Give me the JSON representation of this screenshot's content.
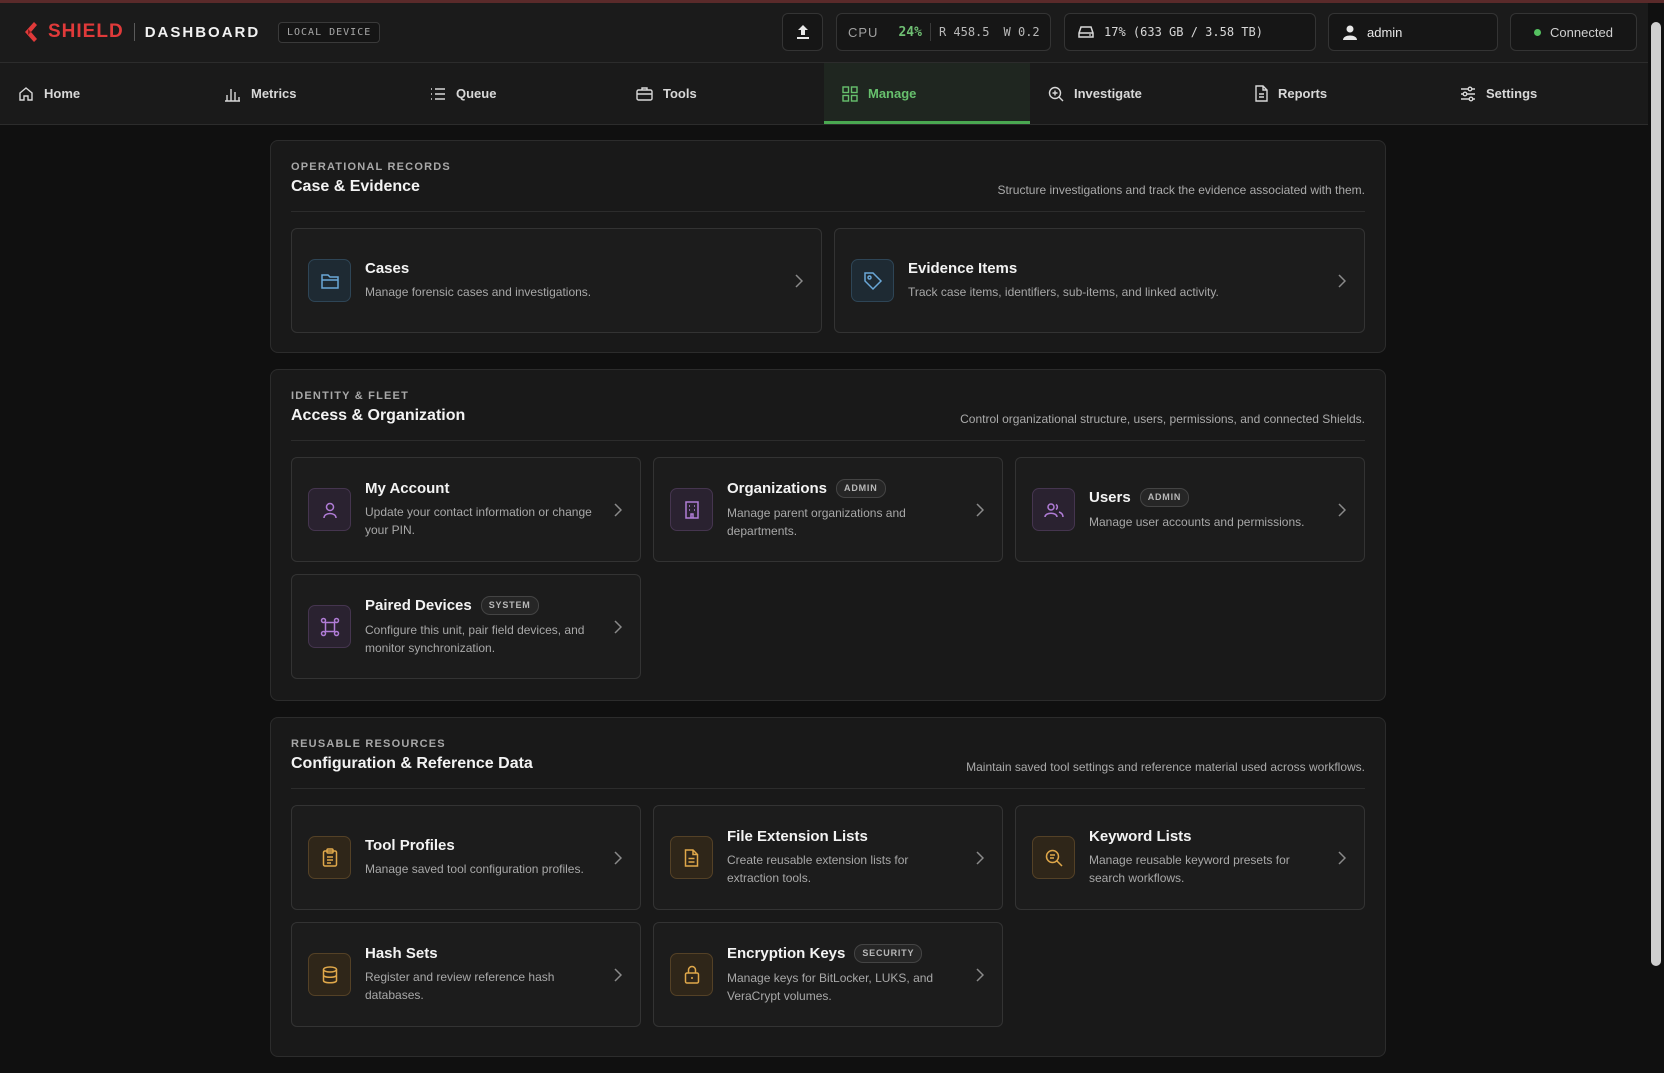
{
  "header": {
    "brand": "SHIELD",
    "section": "DASHBOARD",
    "device_badge": "LOCAL DEVICE",
    "cpu_label": "CPU",
    "cpu_percent": "24%",
    "read": "R 458.5",
    "write": "W 0.2",
    "disk": "17% (633 GB / 3.58 TB)",
    "user": "admin",
    "connection": "Connected"
  },
  "nav": {
    "active": "Manage",
    "items": [
      {
        "label": "Home",
        "icon": "home-icon"
      },
      {
        "label": "Metrics",
        "icon": "bar-chart-icon"
      },
      {
        "label": "Queue",
        "icon": "list-icon"
      },
      {
        "label": "Tools",
        "icon": "toolbox-icon"
      },
      {
        "label": "Manage",
        "icon": "grid-icon"
      },
      {
        "label": "Investigate",
        "icon": "zoom-icon"
      },
      {
        "label": "Reports",
        "icon": "document-icon"
      },
      {
        "label": "Settings",
        "icon": "sliders-icon"
      }
    ]
  },
  "sections": [
    {
      "eyebrow": "OPERATIONAL RECORDS",
      "title": "Case & Evidence",
      "description": "Structure investigations and track the evidence associated with them.",
      "cards": [
        {
          "title": "Cases",
          "desc": "Manage forensic cases and investigations.",
          "icon": "folder-icon"
        },
        {
          "title": "Evidence Items",
          "desc": "Track case items, identifiers, sub-items, and linked activity.",
          "icon": "tag-icon"
        }
      ]
    },
    {
      "eyebrow": "IDENTITY & FLEET",
      "title": "Access & Organization",
      "description": "Control organizational structure, users, permissions, and connected Shields.",
      "cards": [
        {
          "title": "My Account",
          "desc": "Update your contact information or change your PIN.",
          "icon": "user-icon"
        },
        {
          "title": "Organizations",
          "badge": "ADMIN",
          "desc": "Manage parent organizations and departments.",
          "icon": "building-icon"
        },
        {
          "title": "Users",
          "badge": "ADMIN",
          "desc": "Manage user accounts and permissions.",
          "icon": "users-icon"
        },
        {
          "title": "Paired Devices",
          "badge": "SYSTEM",
          "desc": "Configure this unit, pair field devices, and monitor synchronization.",
          "icon": "network-icon"
        }
      ]
    },
    {
      "eyebrow": "REUSABLE RESOURCES",
      "title": "Configuration & Reference Data",
      "description": "Maintain saved tool settings and reference material used across workflows.",
      "cards": [
        {
          "title": "Tool Profiles",
          "desc": "Manage saved tool configuration profiles.",
          "icon": "clipboard-icon"
        },
        {
          "title": "File Extension Lists",
          "desc": "Create reusable extension lists for extraction tools.",
          "icon": "file-text-icon"
        },
        {
          "title": "Keyword Lists",
          "desc": "Manage reusable keyword presets for search workflows.",
          "icon": "search-list-icon"
        },
        {
          "title": "Hash Sets",
          "desc": "Register and review reference hash databases.",
          "icon": "database-icon"
        },
        {
          "title": "Encryption Keys",
          "badge": "SECURITY",
          "desc": "Manage keys for BitLocker, LUKS, and VeraCrypt volumes.",
          "icon": "lock-icon"
        }
      ]
    }
  ],
  "colors": {
    "brand": "#e03a3a",
    "accent_green": "#67c06d",
    "blue_icon": "#6aa8d8",
    "purple_icon": "#b07cd6",
    "amber_icon": "#e0a84a"
  }
}
